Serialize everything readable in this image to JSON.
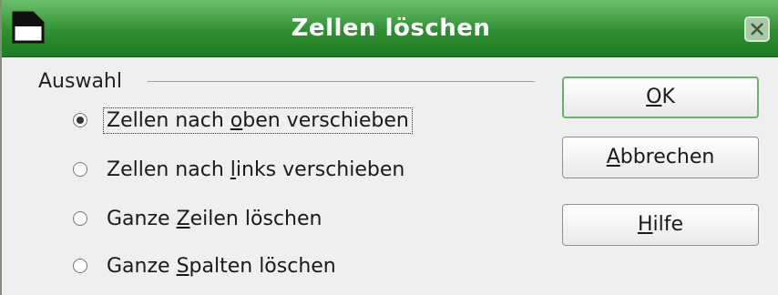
{
  "dialog": {
    "title": "Zellen löschen"
  },
  "selection": {
    "group_label": "Auswahl",
    "options": [
      {
        "pre": "Zellen nach ",
        "key": "o",
        "post": "ben verschieben",
        "checked": true
      },
      {
        "pre": "Zellen nach ",
        "key": "l",
        "post": "inks verschieben",
        "checked": false
      },
      {
        "pre": "Ganze ",
        "key": "Z",
        "post": "eilen löschen",
        "checked": false
      },
      {
        "pre": "Ganze ",
        "key": "S",
        "post": "palten löschen",
        "checked": false
      }
    ]
  },
  "buttons": {
    "ok": {
      "key": "O",
      "rest": "K"
    },
    "cancel": {
      "key": "A",
      "rest": "bbrechen"
    },
    "help": {
      "key": "H",
      "rest": "ilfe"
    }
  },
  "icons": {
    "app": "document-icon",
    "close": "close-icon"
  },
  "colors": {
    "titlebar": "#2f8f32",
    "default_button_border": "#6bb06b"
  }
}
